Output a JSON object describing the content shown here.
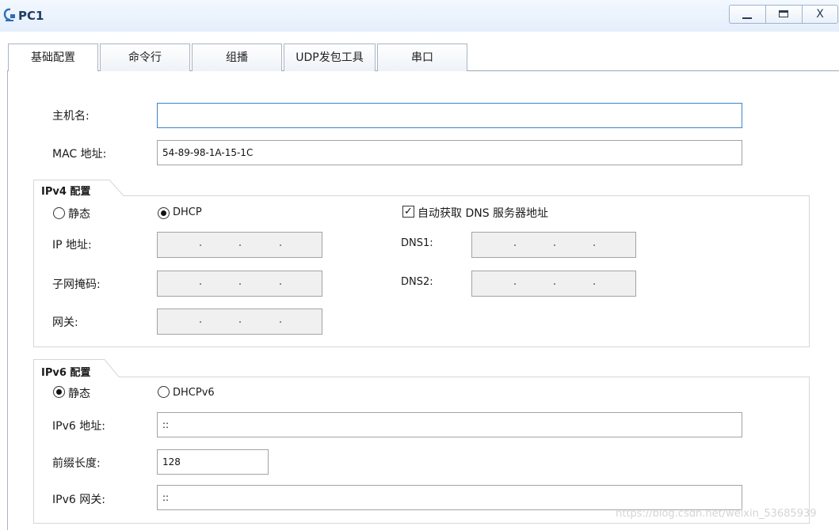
{
  "window": {
    "title": "PC1",
    "minimize_glyph": "_",
    "close_glyph": "X"
  },
  "tabs": [
    {
      "label": "基础配置"
    },
    {
      "label": "命令行"
    },
    {
      "label": "组播"
    },
    {
      "label": "UDP发包工具"
    },
    {
      "label": "串口"
    }
  ],
  "basic": {
    "hostname_label": "主机名:",
    "hostname_value": "",
    "mac_label": "MAC 地址:",
    "mac_value": "54-89-98-1A-15-1C"
  },
  "ipv4": {
    "group_title": "IPv4 配置",
    "static_label": "静态",
    "dhcp_label": "DHCP",
    "mode": "DHCP",
    "auto_dns_label": "自动获取 DNS 服务器地址",
    "auto_dns_checked": true,
    "ip_label": "IP 地址:",
    "mask_label": "子网掩码:",
    "gateway_label": "网关:",
    "dns1_label": "DNS1:",
    "dns2_label": "DNS2:",
    "ip_separator": "."
  },
  "ipv6": {
    "group_title": "IPv6 配置",
    "static_label": "静态",
    "dhcp_label": "DHCPv6",
    "mode": "静态",
    "addr_label": "IPv6 地址:",
    "addr_value": "::",
    "prefix_label": "前缀长度:",
    "prefix_value": "128",
    "gateway_label": "IPv6 网关:",
    "gateway_value": "::"
  },
  "watermark": "https://blog.csdn.net/weixin_53685939",
  "colors": {
    "titlebar": "#e4eefb",
    "title_text": "#1e3d63",
    "focus_border": "#3b83cf",
    "disabled_field": "#f0f0f0"
  },
  "icons": {
    "app": "network-pc-icon",
    "minimize": "minimize-icon",
    "maximize": "maximize-icon",
    "close": "close-icon"
  }
}
